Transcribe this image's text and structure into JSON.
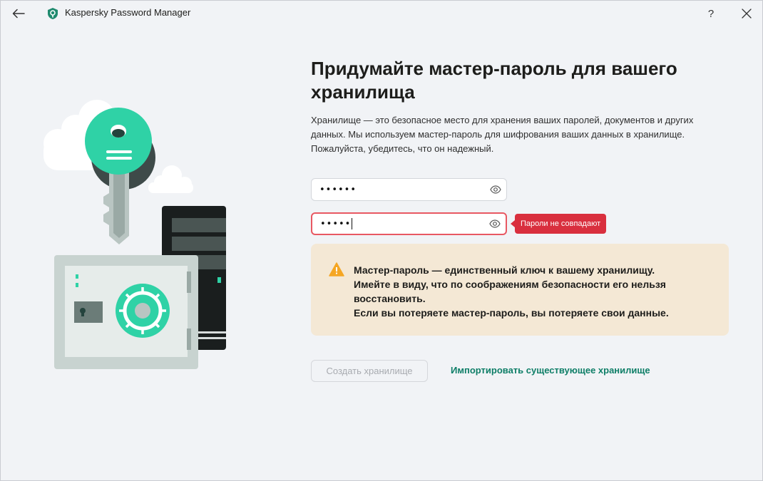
{
  "window": {
    "title": "Kaspersky Password Manager",
    "help_label": "?"
  },
  "main": {
    "heading_line1": "Придумайте мастер-пароль для вашего",
    "heading_line2": "хранилища",
    "description_line1": "Хранилище — это безопасное место для хранения ваших паролей, документов и других",
    "description_line2": "данных. Мы используем мастер-пароль для шифрования ваших данных в хранилище.",
    "description_line3": "Пожалуйста, убедитесь, что он надежный.",
    "password_field": {
      "value": "••••••"
    },
    "confirm_field": {
      "value": "•••••"
    },
    "error_tooltip": "Пароли не совпадают",
    "warning": {
      "line1": "Мастер-пароль — единственный ключ к вашему хранилищу.",
      "line2": "Имейте в виду, что по соображениям безопасности его нельзя",
      "line3": "восстановить.",
      "line4": "Если вы потеряете мастер-пароль, вы потеряете свои данные."
    },
    "create_button": "Создать хранилище",
    "import_link": "Импортировать существующее хранилище"
  },
  "colors": {
    "accent": "#0e7e67",
    "key_green": "#2fd2a6",
    "error": "#d92f3e",
    "warning_bg": "#f4e8d5",
    "warning_icon": "#f5a623"
  }
}
